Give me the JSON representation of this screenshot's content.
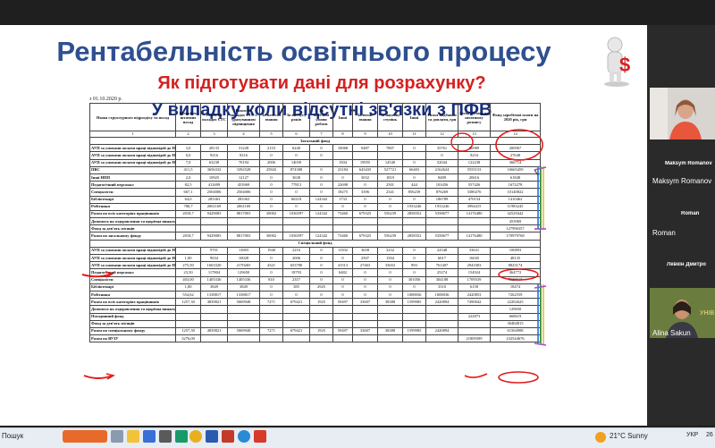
{
  "slide": {
    "title": "Рентабельність освітнього процесу",
    "subtitle": "Як підготувати дані для розрахунку?",
    "subtitle2": "У випадку коли відсутні зв'язки з ПФВ",
    "date": "з 01.10.2020 р."
  },
  "table": {
    "headers": [
      "Назва структурного підрозділу та посад",
      "Кількість штатних посад",
      "Разом по окладах ЄТС",
      "Разом по окладах ЄТС з урахуванням підвищення",
      "За почесні звання",
      "За вислугу років",
      "За особливі умови роботи",
      "Інші",
      "За вчене звання",
      "За наукову ступінь",
      "Інші",
      "Разом надбавки та доплати, грн",
      "Фонд оплати по штатному розпису",
      "Фонд заробітної плати на 2020 рік, грн"
    ],
    "group_headers": {
      "allowances": "Надбавки по видам (грн)",
      "extra": "Доплати по видам (грн)"
    },
    "col_numbers": [
      "1",
      "2",
      "3",
      "4",
      "5",
      "6",
      "7",
      "8",
      "9",
      "10",
      "11",
      "12",
      "13",
      "14"
    ],
    "section1": "Загальний фонд",
    "rows1": [
      [
        "АУП за умовами оплати праці відповідей до НПП (ректор, проректори)",
        "3,0",
        "28133",
        "31228",
        "2153",
        "6240",
        "0",
        "10068",
        "9487",
        "7807",
        "0",
        "35761",
        "66989",
        "200967"
      ],
      [
        "АУП за умовами оплати праці відповідей до НПП (проректори)",
        "0,0",
        "9216",
        "9216",
        "0",
        "0",
        "0",
        "",
        "",
        "",
        "",
        "0",
        "9216",
        "27648"
      ],
      [
        "АУП за умовами оплати праці відповідей до НПП (деканы)",
        "7,0",
        "63238",
        "70194",
        "2006",
        "14039",
        "",
        "1504",
        "19955",
        "14540",
        "0",
        "52044",
        "122238",
        "366714"
      ],
      [
        "ПВС",
        "411,5",
        "3656332",
        "3392528",
        "25843",
        "874308",
        "0",
        "23184",
        "643435",
        "527721",
        "66403",
        "2162624",
        "5555153",
        "16665459"
      ],
      [
        "Інші НПП",
        "2,0",
        "10925",
        "12127",
        "0",
        "3638",
        "0",
        "0",
        "3032",
        "1819",
        "0",
        "8489",
        "20616",
        "61848"
      ],
      [
        "Педагогічний персонал",
        "82,5",
        "412699",
        "453969",
        "0",
        "77813",
        "0",
        "22698",
        "0",
        "2501",
        "444",
        "103456",
        "557426",
        "1672278"
      ],
      [
        "Спеціалісти",
        "667,1",
        "2504006",
        "2504006",
        "0",
        "0",
        "0",
        "18275",
        "3396",
        "2341",
        "856239",
        "876269",
        "3380276",
        "10140822"
      ],
      [
        "Бібліотекарі",
        "64,0",
        "283363",
        "283363",
        "0",
        "60218",
        "124342",
        "1733",
        "0",
        "0",
        "0",
        "186789",
        "470154",
        "1410462"
      ],
      [
        "Робітники",
        "780,7",
        "2061169",
        "2061169",
        "0",
        "0",
        "0",
        "0",
        "0",
        "0",
        "1933246",
        "1933246",
        "3994415",
        "11983245"
      ],
      [
        "Разом по всіх категоріях працівників",
        "2018,7",
        "9429083",
        "8817003",
        "30002",
        "1036597",
        "124342",
        "73460",
        "679325",
        "556239",
        "2858352",
        "5358677",
        "14176480",
        "42529442"
      ],
      [
        "Допомога на оздоровлення та щорічна винагорода педагогічним працівникам",
        "",
        "",
        "",
        "",
        "",
        "",
        "",
        "",
        "",
        "",
        "",
        "",
        "453969"
      ],
      [
        "Фонд за дев'ять місяців",
        "",
        "",
        "",
        "",
        "",
        "",
        "",
        "",
        "",
        "",
        "",
        "",
        "127996357"
      ],
      [
        "Разом по загальному фонду",
        "2018,7",
        "9429083",
        "8817003",
        "30002",
        "1036597",
        "124342",
        "73460",
        "679325",
        "556239",
        "2858352",
        "5358677",
        "14176480",
        "170979768"
      ]
    ],
    "section2": "Спеціальний фонд",
    "rows2": [
      [
        "АУП за умовами оплати праці відповідей до НПП (ректор, проректори)",
        "",
        "9701",
        "11083",
        "1940",
        "2216",
        "0",
        "11502",
        "3658",
        "3232",
        "0",
        "22548",
        "33631",
        "100893"
      ],
      [
        "АУП за умовами оплати праці відповідей до НПП (проректори)",
        "1,00",
        "9034",
        "10028",
        "0",
        "2006",
        "0",
        "0",
        "2507",
        "1504",
        "0",
        "6017",
        "16045",
        "48135"
      ],
      [
        "АУП за умовами оплати праці відповідей до НПП (деканы)",
        "275,50",
        "1663320",
        "2170265",
        "4321",
        "653780",
        "0",
        "41513",
        "27463",
        "33652",
        "893",
        "761407",
        "2941003",
        "8823174"
      ],
      [
        "Педагогічний персонал",
        "23,50",
        "117804",
        "129650",
        "0",
        "18793",
        "0",
        "6482",
        "0",
        "0",
        "0",
        "25274",
        "154924",
        "464772"
      ],
      [
        "Спеціалісти",
        "403,00",
        "1405336",
        "1405336",
        "810",
        "2357",
        "0",
        "0",
        "0",
        "0",
        "301056",
        "304188",
        "1709539",
        "5128617"
      ],
      [
        "Бібліотекарі",
        "1,00",
        "3849",
        "3849",
        "0",
        "385",
        "2925",
        "0",
        "0",
        "0",
        "0",
        "3310",
        "6158",
        "18474"
      ],
      [
        "Робітники",
        "554,62",
        "1338817",
        "1338817",
        "0",
        "0",
        "0",
        "0",
        "0",
        "0",
        "1008036",
        "1008036",
        "2420853",
        "7262559"
      ],
      [
        "Разом по всіх категоріях працівників",
        "1257,30",
        "4839821",
        "5069948",
        "7271",
        "679421",
        "1925",
        "59497",
        "33607",
        "38388",
        "1599985",
        "2420894",
        "7490042",
        "22202625"
      ],
      [
        "Допомога на оздоровлення та щорічна винагорода педагогічним працівникам",
        "",
        "",
        "",
        "",
        "",
        "",
        "",
        "",
        "",
        "",
        "",
        "",
        "129650"
      ],
      [
        "Погодинний фонд",
        "",
        "",
        "",
        "",
        "",
        "",
        "",
        "",
        "",
        "",
        "",
        "222873",
        "668619"
      ],
      [
        "Фонд за дев'ять місяців",
        "",
        "",
        "",
        "",
        "",
        "",
        "",
        "",
        "",
        "",
        "",
        "",
        "30404815"
      ],
      [
        "Разом по спеціальному фонду",
        "1257,30",
        "4839821",
        "5069948",
        "7271",
        "679421",
        "1925",
        "59497",
        "33607",
        "38388",
        "1599985",
        "2420894",
        "",
        "61564908"
      ],
      [
        "Разом по ВУЗУ",
        "3276,00",
        "",
        "",
        "",
        "",
        "",
        "",
        "",
        "",
        "",
        "",
        "21809399",
        "232544676"
      ]
    ]
  },
  "participants": [
    {
      "name": "Maksym Romanov",
      "short": "Maksym Romanov",
      "caption": "Maksym Romanov"
    },
    {
      "name": "Roman",
      "short": "Roman",
      "caption": "Roman"
    },
    {
      "name": "Левкін Дмитро",
      "short": "Левкін Дмитро",
      "caption": "Левкін Дмитро"
    },
    {
      "name": "Alina Sakun",
      "caption": "Alina Sakun"
    }
  ],
  "taskbar": {
    "left_text": "Пошук",
    "weather": "21°C  Sunny",
    "lang": "УКР",
    "time": "26"
  },
  "colors": {
    "title": "#2f4f8f",
    "subtitle": "#d42020",
    "subtitle2": "#1a2f7a",
    "annotation": "#e21a1a"
  }
}
